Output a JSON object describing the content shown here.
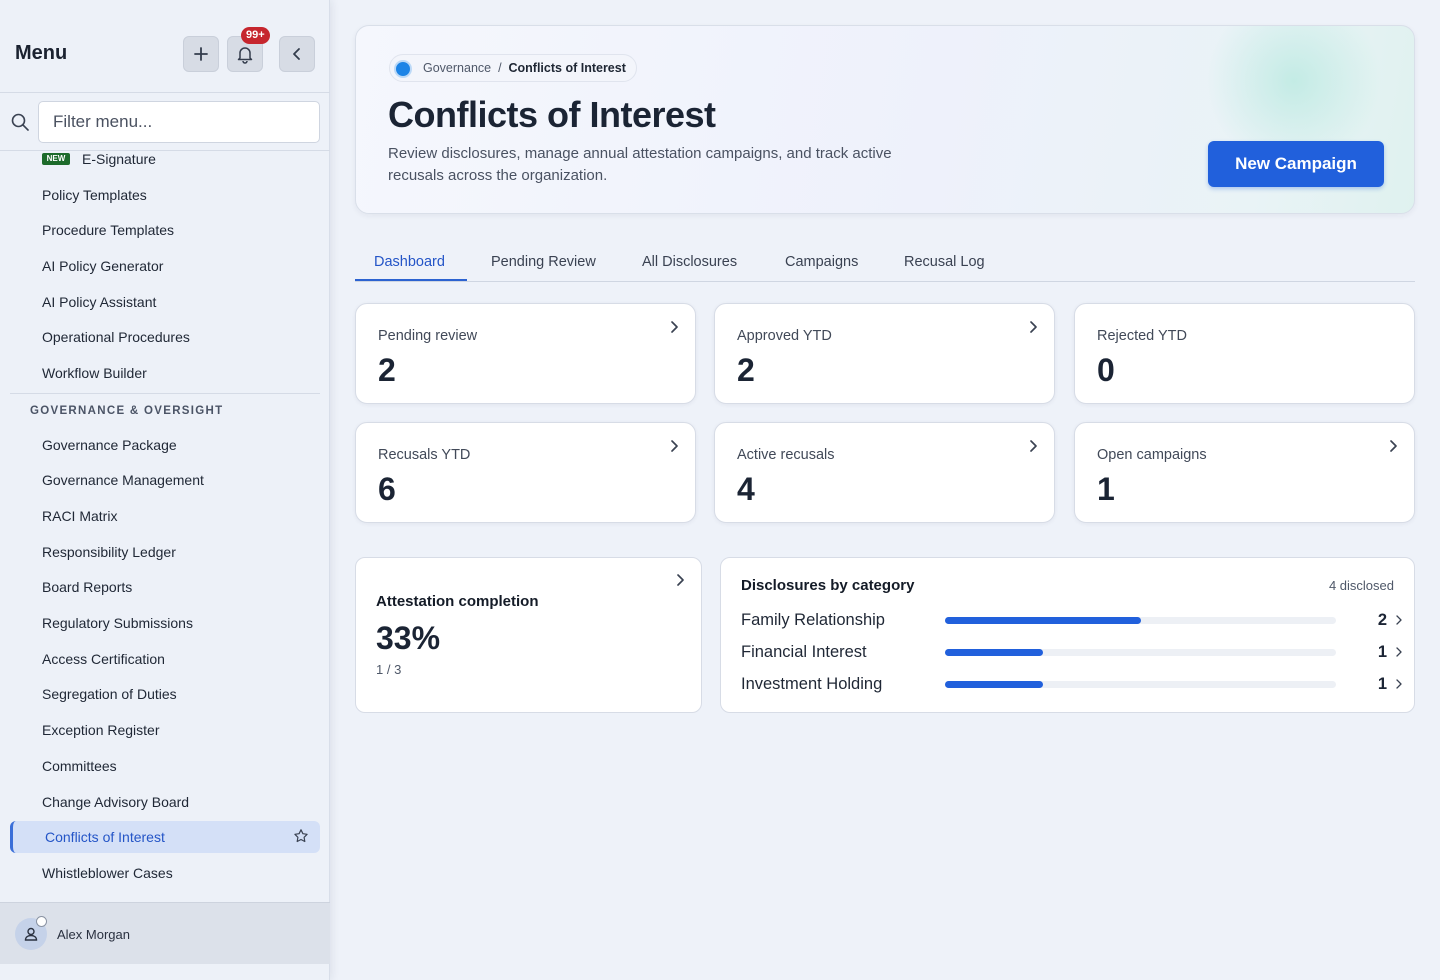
{
  "sidebar": {
    "title": "Menu",
    "notification_count": "99+",
    "search_placeholder": "Filter menu...",
    "new_badge": "NEW",
    "items_top": [
      "E-Signature",
      "Policy Templates",
      "Procedure Templates",
      "AI Policy Generator",
      "AI Policy Assistant",
      "Operational Procedures",
      "Workflow Builder"
    ],
    "section_label": "GOVERNANCE & OVERSIGHT",
    "items_gov": [
      "Governance Package",
      "Governance Management",
      "RACI Matrix",
      "Responsibility Ledger",
      "Board Reports",
      "Regulatory Submissions",
      "Access Certification",
      "Segregation of Duties",
      "Exception Register",
      "Committees",
      "Change Advisory Board",
      "Conflicts of Interest",
      "Whistleblower Cases"
    ],
    "active_item": "Conflicts of Interest",
    "user_name": "Alex Morgan"
  },
  "header": {
    "breadcrumb_parent": "Governance",
    "breadcrumb_sep": "/",
    "breadcrumb_current": "Conflicts of Interest",
    "title": "Conflicts of Interest",
    "subtitle": "Review disclosures, manage annual attestation campaigns, and track active recusals across the organization.",
    "new_campaign_label": "New Campaign"
  },
  "tabs": [
    "Dashboard",
    "Pending Review",
    "All Disclosures",
    "Campaigns",
    "Recusal Log"
  ],
  "active_tab": "Dashboard",
  "stats": [
    {
      "label": "Pending review",
      "value": "2",
      "has_link": true
    },
    {
      "label": "Approved YTD",
      "value": "2",
      "has_link": true
    },
    {
      "label": "Rejected YTD",
      "value": "0",
      "has_link": false
    },
    {
      "label": "Recusals YTD",
      "value": "6",
      "has_link": true
    },
    {
      "label": "Active recusals",
      "value": "4",
      "has_link": true
    },
    {
      "label": "Open campaigns",
      "value": "1",
      "has_link": true
    }
  ],
  "attestation": {
    "title": "Attestation completion",
    "percent": "33%",
    "count": "1 / 3"
  },
  "categories": {
    "title": "Disclosures by category",
    "total_label": "4 disclosed",
    "rows": [
      {
        "name": "Family Relationship",
        "value": "2",
        "fraction": 0.5
      },
      {
        "name": "Financial Interest",
        "value": "1",
        "fraction": 0.25
      },
      {
        "name": "Investment Holding",
        "value": "1",
        "fraction": 0.25
      }
    ]
  },
  "colors": {
    "accent": "#2160dc",
    "badge_red": "#c6262e",
    "new_green": "#1d6b2b"
  }
}
